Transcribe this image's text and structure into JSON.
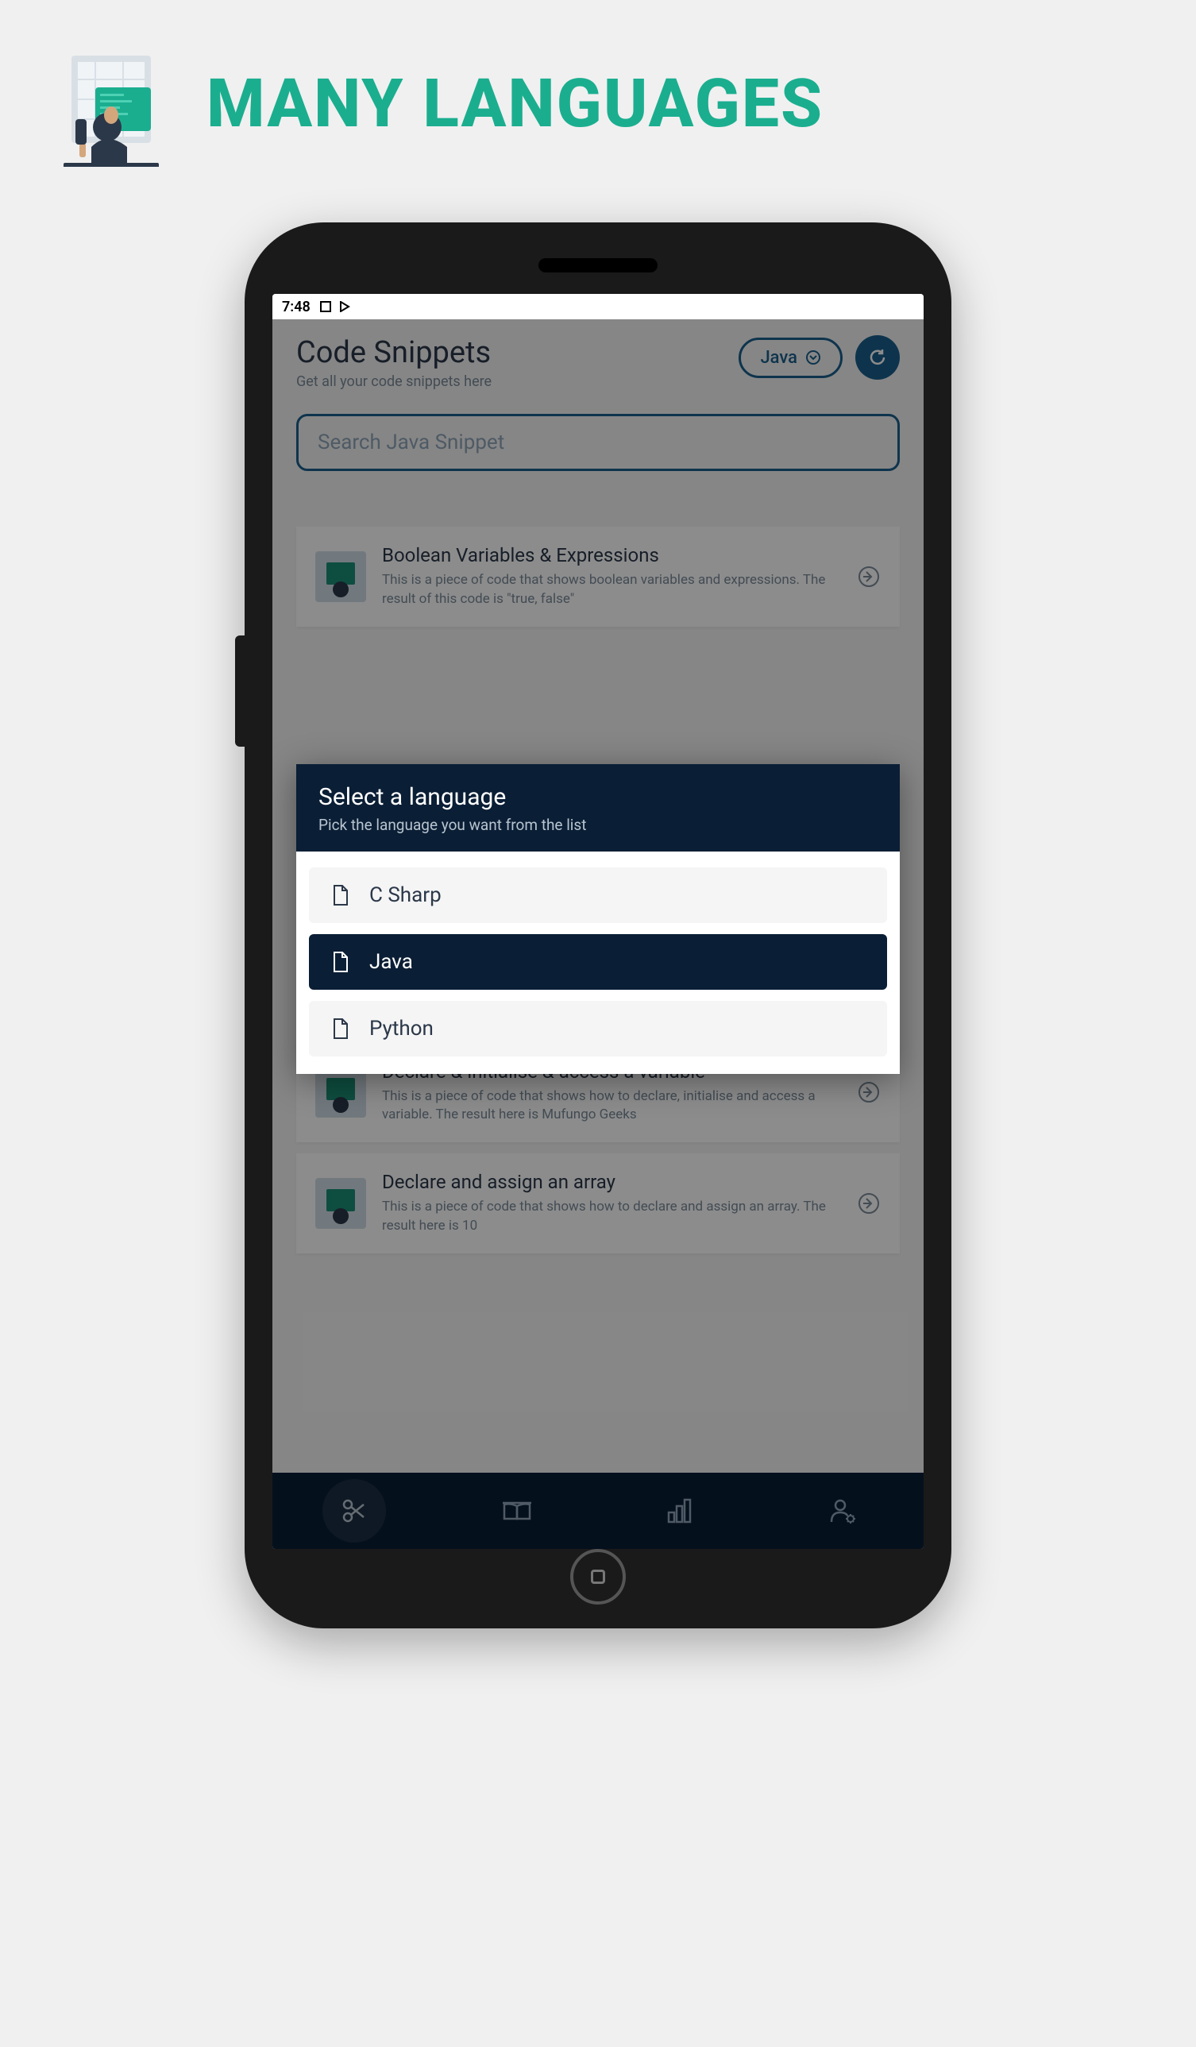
{
  "banner": {
    "title": "MANY LANGUAGES"
  },
  "status": {
    "time": "7:48"
  },
  "header": {
    "title": "Code Snippets",
    "subtitle": "Get all your code snippets here",
    "lang_label": "Java"
  },
  "search": {
    "placeholder": "Search Java Snippet"
  },
  "snippets": [
    {
      "title": "Boolean Variables & Expressions",
      "desc": "This is a piece of code that shows boolean variables and expressions. The result of this code is \"true, false\""
    },
    {
      "title": "Declare & initialise & access a variable",
      "desc": "This is a piece of code that shows how to declare, initialise and access a variable. The result here is Mufungo Geeks"
    },
    {
      "title": "Declare and assign an array",
      "desc": "This is a piece of code that shows how to declare and assign an array. The result here is 10"
    }
  ],
  "modal": {
    "title": "Select a language",
    "subtitle": "Pick the language you want from the list",
    "items": [
      "C Sharp",
      "Java",
      "Python"
    ],
    "selected_index": 1
  }
}
